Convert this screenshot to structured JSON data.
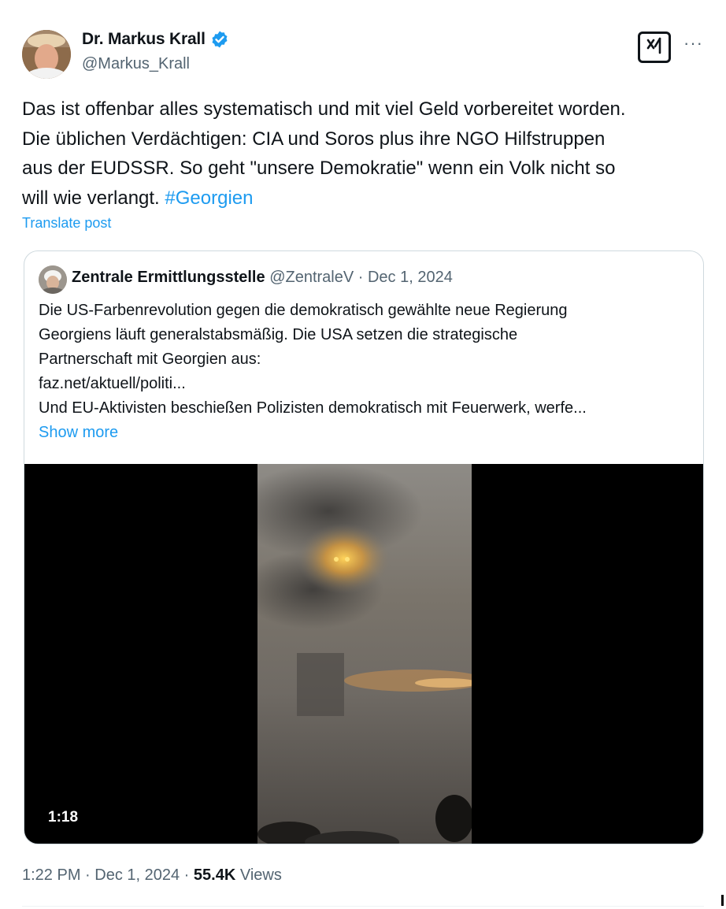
{
  "post": {
    "author_name": "Dr. Markus Krall",
    "author_handle": "@Markus_Krall",
    "text_lines": [
      "Das ist offenbar alles systematisch und mit viel Geld vorbereitet worden.",
      "Die üblichen Verdächtigen: CIA und Soros plus ihre NGO Hilfstruppen",
      "aus der EUDSSR. So geht \"unsere Demokratie\" wenn ein Volk nicht so",
      "will wie verlangt. "
    ],
    "hashtag": "#Georgien",
    "translate_label": "Translate post",
    "more_label": "···",
    "grok_label": "x/"
  },
  "quote": {
    "author_name": "Zentrale Ermittlungsstelle",
    "author_handle": "@ZentraleV",
    "separator": " · ",
    "date": "Dec 1, 2024",
    "text_lines": [
      "Die US-Farbenrevolution gegen die demokratisch gewählte neue Regierung",
      "Georgiens läuft generalstabsmäßig. Die USA setzen die strategische",
      "Partnerschaft mit Georgien aus:",
      "faz.net/aktuell/politi...",
      "Und EU-Aktivisten beschießen Polizisten demokratisch mit Feuerwerk, werfe..."
    ],
    "show_more_label": "Show more",
    "video_duration": "1:18"
  },
  "footer": {
    "time": "1:22 PM",
    "date": "Dec 1, 2024",
    "separator": " · ",
    "views_count": "55.4K",
    "views_label": " Views"
  },
  "colors": {
    "accent": "#1d9bf0",
    "text_primary": "#0f1419",
    "text_secondary": "#536471",
    "border": "#cfd9de"
  },
  "icons": {
    "verified": "verified-badge-icon",
    "grok": "grok-icon",
    "more": "more-options-icon"
  }
}
